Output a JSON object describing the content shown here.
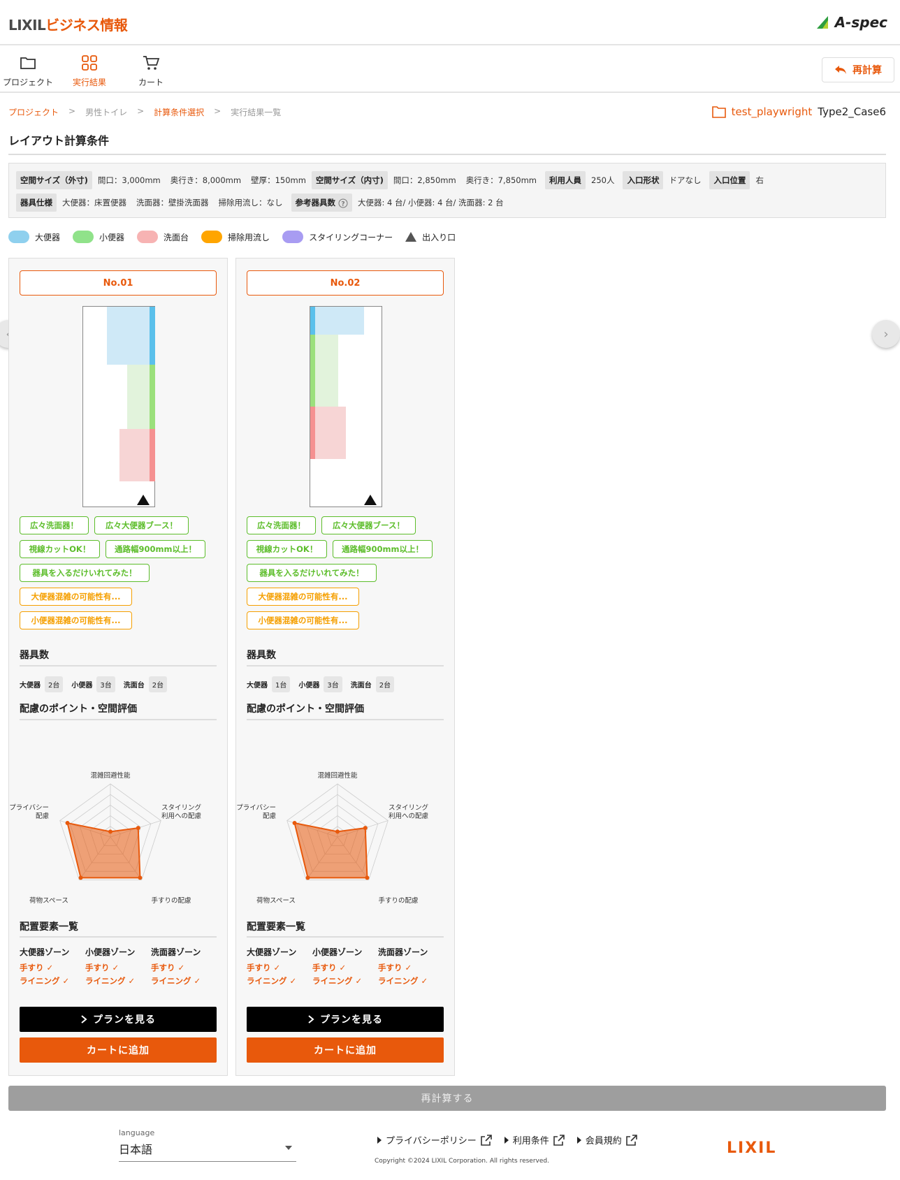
{
  "header": {
    "brand_main": "LIXIL",
    "brand_sub": "ビジネス情報",
    "product_logo": "A-spec"
  },
  "nav": {
    "items": [
      {
        "label": "プロジェクト",
        "icon": "folder-icon"
      },
      {
        "label": "実行結果",
        "icon": "grid-icon",
        "active": true
      },
      {
        "label": "カート",
        "icon": "cart-icon"
      }
    ],
    "recalc_label": "再計算"
  },
  "breadcrumb": [
    "プロジェクト",
    "男性トイレ",
    "計算条件選択",
    "実行結果一覧"
  ],
  "breadcrumb_sep": ">",
  "project": {
    "name": "test_playwright",
    "case": "Type2_Case6"
  },
  "section_title": "レイアウト計算条件",
  "conditions": {
    "outer_label": "空間サイズ（外寸)",
    "outer_width": "間口：3,000mm",
    "outer_depth": "奥行き：8,000mm",
    "wall": "壁厚：150mm",
    "inner_label": "空間サイズ（内寸)",
    "inner_width": "間口：2,850mm",
    "inner_depth": "奥行き：7,850mm",
    "users_label": "利用人員",
    "users_value": "250人",
    "entry_shape_label": "入口形状",
    "entry_shape_value": "ドアなし",
    "entry_pos_label": "入口位置",
    "entry_pos_value": "右",
    "fixture_label": "器具仕様",
    "toilet_spec": "大便器：床置便器",
    "basin_spec": "洗面器：壁掛洗面器",
    "mop_spec": "掃除用流し：なし",
    "ref_label": "参考器具数",
    "ref_value": "大便器: 4 台/ 小便器: 4 台/ 洗面器: 2 台"
  },
  "legend": [
    {
      "label": "大便器",
      "color": "#8fd0ee"
    },
    {
      "label": "小便器",
      "color": "#90e28a"
    },
    {
      "label": "洗面台",
      "color": "#f7b3b3"
    },
    {
      "label": "掃除用流し",
      "color": "#ffa500"
    },
    {
      "label": "スタイリングコーナー",
      "color": "#a89cf2"
    },
    {
      "label": "出入り口",
      "color": "#555555"
    }
  ],
  "cards": [
    {
      "no": "No.01",
      "chips_green": [
        "広々洗面器！",
        "広々大便器ブース！",
        "視線カットOK！",
        "通路幅900mm以上！",
        "器具を入るだけいれてみた！"
      ],
      "chips_orange": [
        "大便器混雑の可能性有...",
        "小便器混雑の可能性有..."
      ],
      "fixtures_title": "器具数",
      "counts": [
        {
          "label": "大便器",
          "value": "2台"
        },
        {
          "label": "小便器",
          "value": "3台"
        },
        {
          "label": "洗面台",
          "value": "2台"
        }
      ],
      "eval_title": "配慮のポイント・空間評価",
      "radar_labels": [
        "混雑回避性能",
        "スタイリング",
        "利用への配慮",
        "手すりの配慮",
        "荷物スペース",
        "プライバシー",
        "配慮"
      ],
      "radar_values": [
        0.1,
        0.55,
        0.95,
        0.95,
        0.85
      ],
      "elements_title": "配置要素一覧",
      "elements": [
        {
          "head": "大便器ゾーン",
          "items": [
            "手すり",
            "ライニング"
          ]
        },
        {
          "head": "小便器ゾーン",
          "items": [
            "手すり",
            "ライニング"
          ]
        },
        {
          "head": "洗面器ゾーン",
          "items": [
            "手すり",
            "ライニング"
          ]
        }
      ],
      "plan_label": "プランを見る",
      "cart_label": "カートに追加"
    },
    {
      "no": "No.02",
      "chips_green": [
        "広々洗面器！",
        "広々大便器ブース！",
        "視線カットOK！",
        "通路幅900mm以上！",
        "器具を入るだけいれてみた！"
      ],
      "chips_orange": [
        "大便器混雑の可能性有...",
        "小便器混雑の可能性有..."
      ],
      "fixtures_title": "器具数",
      "counts": [
        {
          "label": "大便器",
          "value": "1台"
        },
        {
          "label": "小便器",
          "value": "3台"
        },
        {
          "label": "洗面台",
          "value": "2台"
        }
      ],
      "eval_title": "配慮のポイント・空間評価",
      "radar_labels": [
        "混雑回避性能",
        "スタイリング",
        "利用への配慮",
        "手すりの配慮",
        "荷物スペース",
        "プライバシー",
        "配慮"
      ],
      "radar_values": [
        0.1,
        0.55,
        0.95,
        0.95,
        0.85
      ],
      "elements_title": "配置要素一覧",
      "elements": [
        {
          "head": "大便器ゾーン",
          "items": [
            "手すり",
            "ライニング"
          ]
        },
        {
          "head": "小便器ゾーン",
          "items": [
            "手すり",
            "ライニング"
          ]
        },
        {
          "head": "洗面器ゾーン",
          "items": [
            "手すり",
            "ライニング"
          ]
        }
      ],
      "plan_label": "プランを見る",
      "cart_label": "カートに追加"
    }
  ],
  "check_mark": "✓",
  "recalc_bottom": "再計算する",
  "footer": {
    "language_label": "language",
    "language_value": "日本語",
    "links": [
      "プライバシーポリシー",
      "利用条件",
      "会員規約"
    ],
    "copyright": "Copyright ©2024 LIXIL Corporation. All rights reserved.",
    "logo": "LIXIL"
  }
}
